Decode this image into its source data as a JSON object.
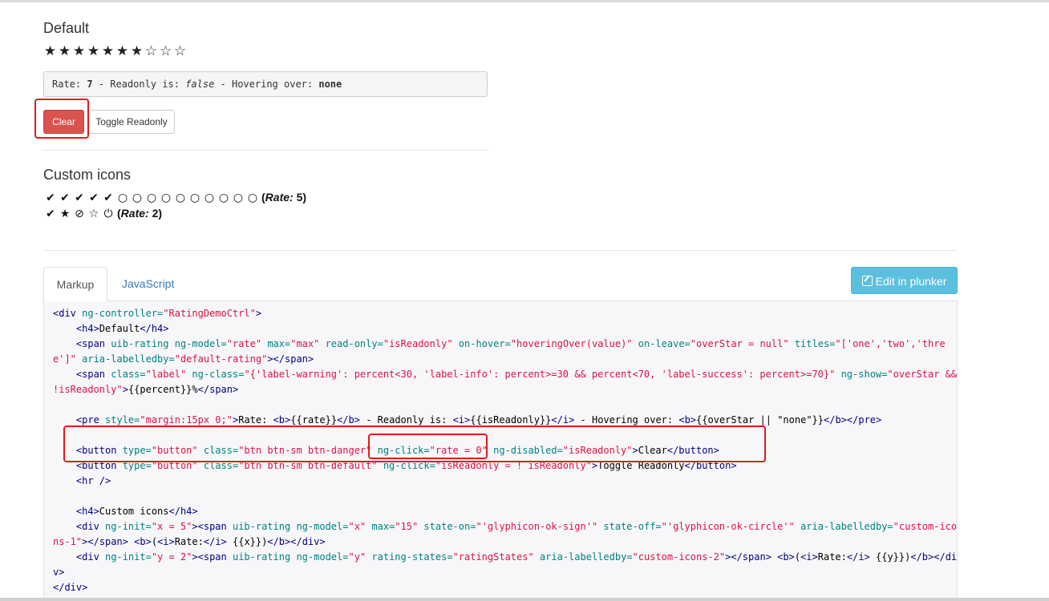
{
  "default_section": {
    "title": "Default",
    "stars": [
      "★",
      "★",
      "★",
      "★",
      "★",
      "★",
      "★",
      "☆",
      "☆",
      "☆"
    ],
    "status": {
      "rate_label": "Rate: ",
      "rate_value": "7",
      "readonly_label": " - Readonly is: ",
      "readonly_value": "false",
      "hover_label": " - Hovering over: ",
      "hover_value": "none"
    },
    "clear_label": "Clear",
    "toggle_label": "Toggle Readonly"
  },
  "custom_section": {
    "title": "Custom icons",
    "row1_icons": [
      "✔",
      "✔",
      "✔",
      "✔",
      "✔",
      "○",
      "○",
      "○",
      "○",
      "○",
      "○",
      "○",
      "○",
      "○",
      "○"
    ],
    "row1_rate_label": "Rate:",
    "row1_rate_value": "5",
    "row2_icons": [
      "✔",
      "★",
      "⊘",
      "☆",
      "⏻"
    ],
    "row2_rate_label": "Rate:",
    "row2_rate_value": "2"
  },
  "tabs": {
    "markup": "Markup",
    "javascript": "JavaScript"
  },
  "edit_plunker": "Edit in plunker",
  "code_lines": [
    [
      [
        "t",
        "<div "
      ],
      [
        "a",
        "ng-controller="
      ],
      [
        "v",
        "\"RatingDemoCtrl\""
      ],
      [
        "t",
        ">"
      ]
    ],
    [
      [
        "t",
        "    <h4>"
      ],
      [
        "x",
        "Default"
      ],
      [
        "t",
        "</h4>"
      ]
    ],
    [
      [
        "t",
        "    <span "
      ],
      [
        "a",
        "uib-rating ng-model="
      ],
      [
        "v",
        "\"rate\""
      ],
      [
        "a",
        " max="
      ],
      [
        "v",
        "\"max\""
      ],
      [
        "a",
        " read-only="
      ],
      [
        "v",
        "\"isReadonly\""
      ],
      [
        "a",
        " on-hover="
      ],
      [
        "v",
        "\"hoveringOver(value)\""
      ],
      [
        "a",
        " on-leave="
      ],
      [
        "v",
        "\"overStar = null\""
      ],
      [
        "a",
        " titles="
      ],
      [
        "v",
        "\"['one','two','thre"
      ]
    ],
    [
      [
        "v",
        "e']\""
      ],
      [
        "a",
        " aria-labelledby="
      ],
      [
        "v",
        "\"default-rating\""
      ],
      [
        "t",
        "></span>"
      ]
    ],
    [
      [
        "t",
        "    <span "
      ],
      [
        "a",
        "class="
      ],
      [
        "v",
        "\"label\""
      ],
      [
        "a",
        " ng-class="
      ],
      [
        "v",
        "\"{'label-warning': percent<30, 'label-info': percent>=30 && percent<70, 'label-success': percent>=70}\""
      ],
      [
        "a",
        " ng-show="
      ],
      [
        "v",
        "\"overStar &&"
      ]
    ],
    [
      [
        "v",
        "!isReadonly\""
      ],
      [
        "t",
        ">"
      ],
      [
        "x",
        "{{percent}}%"
      ],
      [
        "t",
        "</span>"
      ]
    ],
    [
      [
        "x",
        ""
      ]
    ],
    [
      [
        "t",
        "    <pre "
      ],
      [
        "a",
        "style="
      ],
      [
        "v",
        "\"margin:15px 0;\""
      ],
      [
        "t",
        ">"
      ],
      [
        "x",
        "Rate: "
      ],
      [
        "t",
        "<b>"
      ],
      [
        "x",
        "{{rate}}"
      ],
      [
        "t",
        "</b>"
      ],
      [
        "x",
        " - Readonly is: "
      ],
      [
        "t",
        "<i>"
      ],
      [
        "x",
        "{{isReadonly}}"
      ],
      [
        "t",
        "</i>"
      ],
      [
        "x",
        " - Hovering over: "
      ],
      [
        "t",
        "<b>"
      ],
      [
        "x",
        "{{overStar || \"none\"}}"
      ],
      [
        "t",
        "</b></pre>"
      ]
    ],
    [
      [
        "x",
        ""
      ]
    ],
    [
      [
        "t",
        "    <button "
      ],
      [
        "a",
        "type="
      ],
      [
        "v",
        "\"button\""
      ],
      [
        "a",
        " class="
      ],
      [
        "v",
        "\"btn btn-sm btn-danger\""
      ],
      [
        "a",
        " ng-click="
      ],
      [
        "v",
        "\"rate = 0\""
      ],
      [
        "a",
        " ng-disabled="
      ],
      [
        "v",
        "\"isReadonly\""
      ],
      [
        "t",
        ">"
      ],
      [
        "x",
        "Clear"
      ],
      [
        "t",
        "</button>"
      ]
    ],
    [
      [
        "t",
        "    <button "
      ],
      [
        "a",
        "type="
      ],
      [
        "v",
        "\"button\""
      ],
      [
        "a",
        " class="
      ],
      [
        "v",
        "\"btn btn-sm btn-default\""
      ],
      [
        "a",
        " ng-click="
      ],
      [
        "v",
        "\"isReadonly = ! isReadonly\""
      ],
      [
        "t",
        ">"
      ],
      [
        "x",
        "Toggle Readonly"
      ],
      [
        "t",
        "</button>"
      ]
    ],
    [
      [
        "t",
        "    <hr />"
      ]
    ],
    [
      [
        "x",
        ""
      ]
    ],
    [
      [
        "t",
        "    <h4>"
      ],
      [
        "x",
        "Custom icons"
      ],
      [
        "t",
        "</h4>"
      ]
    ],
    [
      [
        "t",
        "    <div "
      ],
      [
        "a",
        "ng-init="
      ],
      [
        "v",
        "\"x = 5\""
      ],
      [
        "t",
        "><span "
      ],
      [
        "a",
        "uib-rating ng-model="
      ],
      [
        "v",
        "\"x\""
      ],
      [
        "a",
        " max="
      ],
      [
        "v",
        "\"15\""
      ],
      [
        "a",
        " state-on="
      ],
      [
        "v",
        "\"'glyphicon-ok-sign'\""
      ],
      [
        "a",
        " state-off="
      ],
      [
        "v",
        "\"'glyphicon-ok-circle'\""
      ],
      [
        "a",
        " aria-labelledby="
      ],
      [
        "v",
        "\"custom-ico"
      ]
    ],
    [
      [
        "v",
        "ns-1\""
      ],
      [
        "t",
        "></span> <b>"
      ],
      [
        "x",
        "("
      ],
      [
        "t",
        "<i>"
      ],
      [
        "x",
        "Rate:"
      ],
      [
        "t",
        "</i>"
      ],
      [
        "x",
        " {{x}})"
      ],
      [
        "t",
        "</b></div>"
      ]
    ],
    [
      [
        "t",
        "    <div "
      ],
      [
        "a",
        "ng-init="
      ],
      [
        "v",
        "\"y = 2\""
      ],
      [
        "t",
        "><span "
      ],
      [
        "a",
        "uib-rating ng-model="
      ],
      [
        "v",
        "\"y\""
      ],
      [
        "a",
        " rating-states="
      ],
      [
        "v",
        "\"ratingStates\""
      ],
      [
        "a",
        " aria-labelledby="
      ],
      [
        "v",
        "\"custom-icons-2\""
      ],
      [
        "t",
        "></span> <b>"
      ],
      [
        "x",
        "("
      ],
      [
        "t",
        "<i>"
      ],
      [
        "x",
        "Rate:"
      ],
      [
        "t",
        "</i>"
      ],
      [
        "x",
        " {{y}})"
      ],
      [
        "t",
        "</b></di"
      ]
    ],
    [
      [
        "t",
        "v>"
      ]
    ],
    [
      [
        "t",
        "</div>"
      ]
    ]
  ]
}
